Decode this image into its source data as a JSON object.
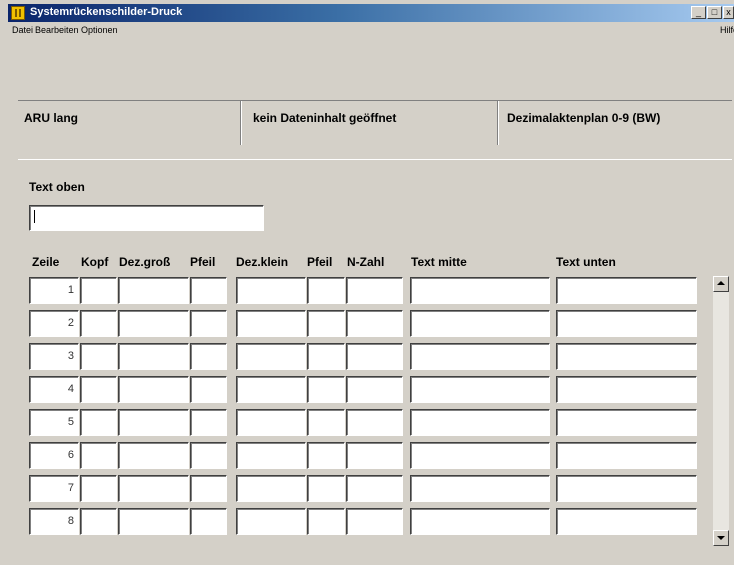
{
  "window": {
    "title": "Systemrückenschilder-Druck"
  },
  "menubar": {
    "items": [
      "Datei",
      "Bearbeiten",
      "Optionen"
    ],
    "help": "Hilfe"
  },
  "toolbar": {
    "icons": [
      "exit-icon",
      "layout-icon",
      "copy-left-icon",
      "copy-both-icon",
      "copy-right-icon",
      "print-preview-icon",
      "print-icon",
      "insert-icon",
      "delete-row-icon",
      "undo-icon",
      "clear-icon",
      "import-icon",
      "search-icon"
    ]
  },
  "info": {
    "left": "ARU lang",
    "center": "kein Dateninhalt geöffnet",
    "right": "Dezimalaktenplan 0-9 (BW)"
  },
  "text_oben": {
    "label": "Text oben",
    "value": ""
  },
  "table": {
    "headers": [
      "Zeile",
      "Kopf",
      "Dez.groß",
      "Pfeil",
      "Dez.klein",
      "Pfeil",
      "N-Zahl",
      "Text mitte",
      "Text unten"
    ],
    "rows": [
      "1",
      "2",
      "3",
      "4",
      "5",
      "6",
      "7",
      "8"
    ]
  },
  "colors": {
    "title_start": "#0a246a",
    "title_end": "#a6caf0",
    "face": "#d4d0c8"
  }
}
